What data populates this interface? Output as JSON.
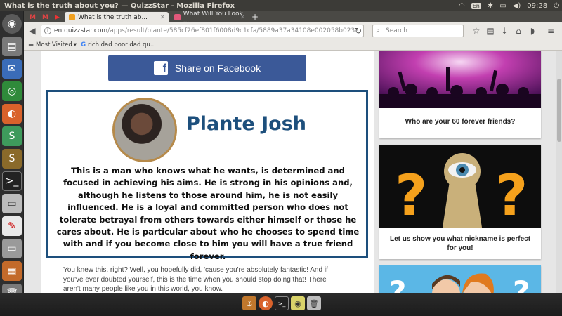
{
  "os": {
    "window_title": "What is the truth about you? — QuizzStar - Mozilla Firefox",
    "clock": "09:28",
    "keyboard": "En"
  },
  "browser": {
    "tabs": [
      {
        "label": "What is the truth ab..."
      },
      {
        "label": "What Will You Look ..."
      }
    ],
    "url_domain": "en.quizzstar.com",
    "url_path": "/apps/result/plante/585cf26ef801f6008d9c1cfa/5889a37a34108e002058b023",
    "search_placeholder": "Search",
    "bookmarks": {
      "most_visited": "Most Visited",
      "item": "rich dad poor dad qu..."
    }
  },
  "main": {
    "share_button": "Share on Facebook",
    "result_name": "Plante Josh",
    "result_text": "This is a man who knows what he wants, is determined and focused in achieving his aims. He is strong in his opinions and, although he listens to those around him, he is not easily influenced. He is a loyal and committed person who does not tolerate betrayal from others towards either himself or those he cares about. He is particular about who he chooses to spend time with and if you become close to him you will have a true friend forever.",
    "followup_text": "You knew this, right? Well, you hopefully did, 'cause you're absolutely fantastic! And if you've ever doubted yourself, this is the time when you should stop doing that! There aren't many people like you in this world, you know."
  },
  "sidebar": {
    "cards": [
      {
        "caption": "Who are your 60 forever friends?"
      },
      {
        "caption": "Let us show you what nickname is perfect for you!"
      },
      {
        "caption": ""
      }
    ]
  },
  "colors": {
    "facebook": "#3b5998",
    "result_border": "#1d4f7c",
    "concert_purple": "#8a1f8c",
    "question_orange": "#f5a11c"
  }
}
